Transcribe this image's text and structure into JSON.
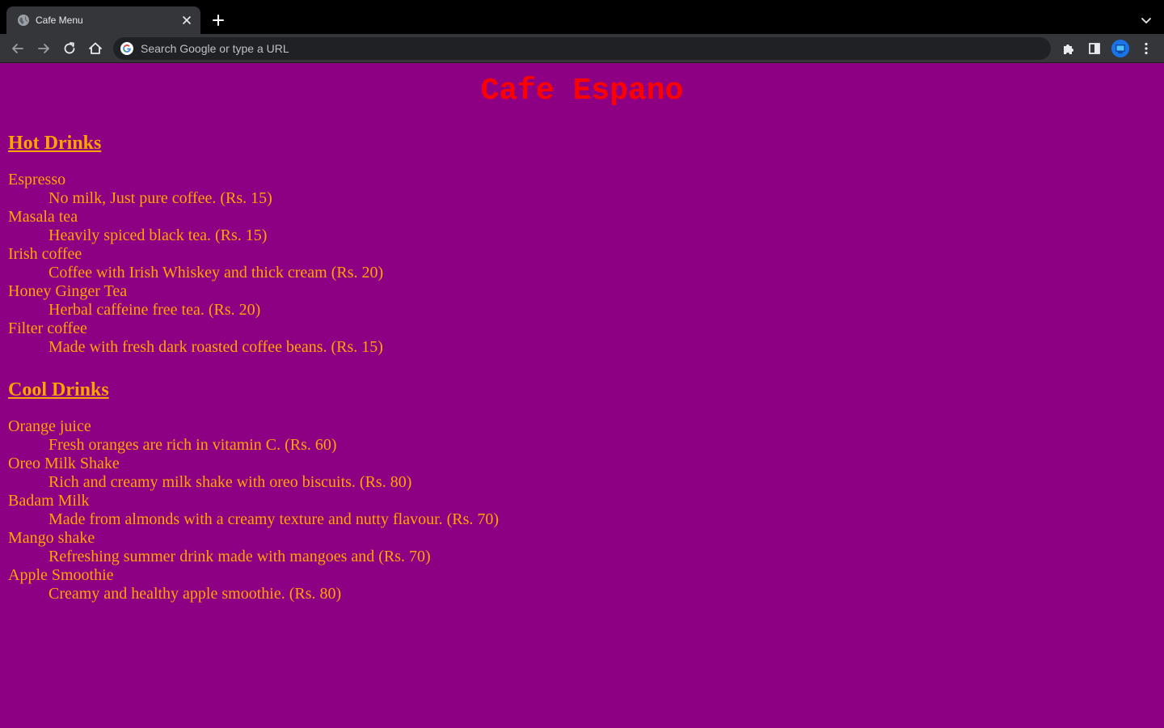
{
  "browser": {
    "tab_title": "Cafe Menu",
    "omnibox_placeholder": "Search Google or type a URL",
    "icons": [
      "globe-icon",
      "close-icon",
      "plus-icon",
      "chevron-down-icon",
      "back-arrow-icon",
      "forward-arrow-icon",
      "reload-icon",
      "home-icon",
      "google-icon",
      "puzzle-icon",
      "side-panel-icon",
      "avatar",
      "kebab-menu-icon"
    ]
  },
  "page": {
    "title": "Cafe Espano",
    "colors": {
      "background": "#8e0083",
      "title": "#ff0000",
      "text": "#ffa500"
    },
    "hot_drinks": {
      "heading": "Hot Drinks",
      "items": [
        {
          "name": "Espresso",
          "desc": "No milk, Just pure coffee. (Rs. 15)"
        },
        {
          "name": "Masala tea",
          "desc": "Heavily spiced black tea. (Rs. 15)"
        },
        {
          "name": "Irish coffee",
          "desc": "Coffee with Irish Whiskey and thick cream (Rs. 20)"
        },
        {
          "name": "Honey Ginger Tea",
          "desc": "Herbal caffeine free tea. (Rs. 20)"
        },
        {
          "name": "Filter coffee",
          "desc": "Made with fresh dark roasted coffee beans. (Rs. 15)"
        }
      ]
    },
    "cool_drinks": {
      "heading": "Cool Drinks",
      "items": [
        {
          "name": "Orange juice",
          "desc": "Fresh oranges are rich in vitamin C. (Rs. 60)"
        },
        {
          "name": "Oreo Milk Shake",
          "desc": "Rich and creamy milk shake with oreo biscuits. (Rs. 80)"
        },
        {
          "name": "Badam Milk",
          "desc": "Made from almonds with a creamy texture and nutty flavour. (Rs. 70)"
        },
        {
          "name": "Mango shake",
          "desc": "Refreshing summer drink made with mangoes and (Rs. 70)"
        },
        {
          "name": "Apple Smoothie",
          "desc": "Creamy and healthy apple smoothie. (Rs. 80)"
        }
      ]
    }
  }
}
